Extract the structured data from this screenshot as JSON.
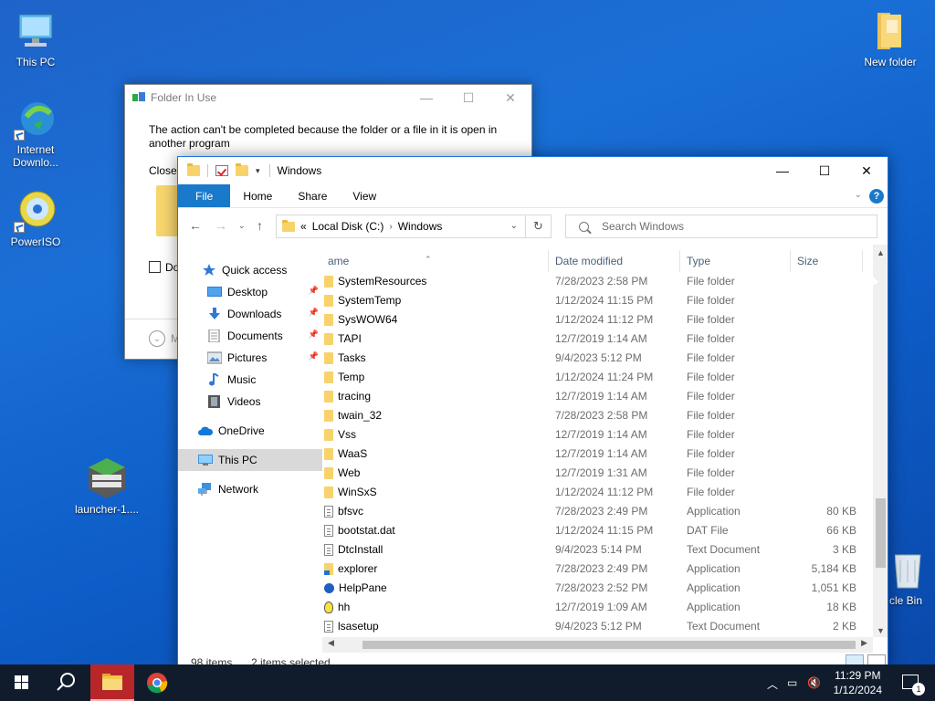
{
  "desktop": {
    "icons": [
      {
        "label": "This PC",
        "icon": "computer-icon"
      },
      {
        "label": "Internet Downlo...",
        "icon": "idm-icon"
      },
      {
        "label": "PowerISO",
        "icon": "disc-icon"
      },
      {
        "label": "launcher-1....",
        "icon": "betacraft-icon"
      },
      {
        "label": "New folder",
        "icon": "folder-icon"
      },
      {
        "label": "cle Bin",
        "icon": "recycle-bin-icon"
      }
    ]
  },
  "dialog": {
    "title": "Folder In Use",
    "message": "The action can't be completed because the folder or a file in it is open in another program",
    "close_label": "Close",
    "checkbox_label": "Do",
    "more_label": "M"
  },
  "explorer": {
    "title": "Windows",
    "window_controls": {
      "minimize": "—",
      "maximize": "☐",
      "close": "✕"
    },
    "ribbon_tabs": [
      "File",
      "Home",
      "Share",
      "View"
    ],
    "help": "?",
    "address": {
      "prefix": "«",
      "crumbs": [
        "Local Disk (C:)",
        "Windows"
      ]
    },
    "search_placeholder": "Search Windows",
    "nav_pane": [
      {
        "label": "Quick access",
        "icon": "star-icon",
        "pinned": false,
        "level": 1
      },
      {
        "label": "Desktop",
        "icon": "desktop-icon",
        "pinned": true,
        "level": 2
      },
      {
        "label": "Downloads",
        "icon": "download-icon",
        "pinned": true,
        "level": 2
      },
      {
        "label": "Documents",
        "icon": "document-icon",
        "pinned": true,
        "level": 2
      },
      {
        "label": "Pictures",
        "icon": "picture-icon",
        "pinned": true,
        "level": 2
      },
      {
        "label": "Music",
        "icon": "music-icon",
        "pinned": false,
        "level": 2
      },
      {
        "label": "Videos",
        "icon": "video-icon",
        "pinned": false,
        "level": 2
      },
      {
        "label": "OneDrive",
        "icon": "cloud-icon",
        "pinned": false,
        "level": 1
      },
      {
        "label": "This PC",
        "icon": "computer-icon",
        "pinned": false,
        "level": 1,
        "selected": true
      },
      {
        "label": "Network",
        "icon": "network-icon",
        "pinned": false,
        "level": 1
      }
    ],
    "columns": [
      "ame",
      "Date modified",
      "Type",
      "Size"
    ],
    "files": [
      {
        "name": "SystemResources",
        "date": "7/28/2023 2:58 PM",
        "type": "File folder",
        "size": "",
        "icon": "folder"
      },
      {
        "name": "SystemTemp",
        "date": "1/12/2024 11:15 PM",
        "type": "File folder",
        "size": "",
        "icon": "folder"
      },
      {
        "name": "SysWOW64",
        "date": "1/12/2024 11:12 PM",
        "type": "File folder",
        "size": "",
        "icon": "folder"
      },
      {
        "name": "TAPI",
        "date": "12/7/2019 1:14 AM",
        "type": "File folder",
        "size": "",
        "icon": "folder"
      },
      {
        "name": "Tasks",
        "date": "9/4/2023 5:12 PM",
        "type": "File folder",
        "size": "",
        "icon": "folder"
      },
      {
        "name": "Temp",
        "date": "1/12/2024 11:24 PM",
        "type": "File folder",
        "size": "",
        "icon": "folder"
      },
      {
        "name": "tracing",
        "date": "12/7/2019 1:14 AM",
        "type": "File folder",
        "size": "",
        "icon": "folder"
      },
      {
        "name": "twain_32",
        "date": "7/28/2023 2:58 PM",
        "type": "File folder",
        "size": "",
        "icon": "folder"
      },
      {
        "name": "Vss",
        "date": "12/7/2019 1:14 AM",
        "type": "File folder",
        "size": "",
        "icon": "folder"
      },
      {
        "name": "WaaS",
        "date": "12/7/2019 1:14 AM",
        "type": "File folder",
        "size": "",
        "icon": "folder"
      },
      {
        "name": "Web",
        "date": "12/7/2019 1:31 AM",
        "type": "File folder",
        "size": "",
        "icon": "folder"
      },
      {
        "name": "WinSxS",
        "date": "1/12/2024 11:12 PM",
        "type": "File folder",
        "size": "",
        "icon": "folder"
      },
      {
        "name": "bfsvc",
        "date": "7/28/2023 2:49 PM",
        "type": "Application",
        "size": "80 KB",
        "icon": "file"
      },
      {
        "name": "bootstat.dat",
        "date": "1/12/2024 11:15 PM",
        "type": "DAT File",
        "size": "66 KB",
        "icon": "file"
      },
      {
        "name": "DtcInstall",
        "date": "9/4/2023 5:14 PM",
        "type": "Text Document",
        "size": "3 KB",
        "icon": "file"
      },
      {
        "name": "explorer",
        "date": "7/28/2023 2:49 PM",
        "type": "Application",
        "size": "5,184 KB",
        "icon": "explorer"
      },
      {
        "name": "HelpPane",
        "date": "7/28/2023 2:52 PM",
        "type": "Application",
        "size": "1,051 KB",
        "icon": "help"
      },
      {
        "name": "hh",
        "date": "12/7/2019 1:09 AM",
        "type": "Application",
        "size": "18 KB",
        "icon": "hh"
      },
      {
        "name": "lsasetup",
        "date": "9/4/2023 5:12 PM",
        "type": "Text Document",
        "size": "2 KB",
        "icon": "file"
      }
    ],
    "status": {
      "items": "98 items",
      "selected": "2 items selected"
    }
  },
  "taskbar": {
    "time": "11:29 PM",
    "date": "1/12/2024",
    "notification_count": "1",
    "accent": "#b8262a"
  }
}
